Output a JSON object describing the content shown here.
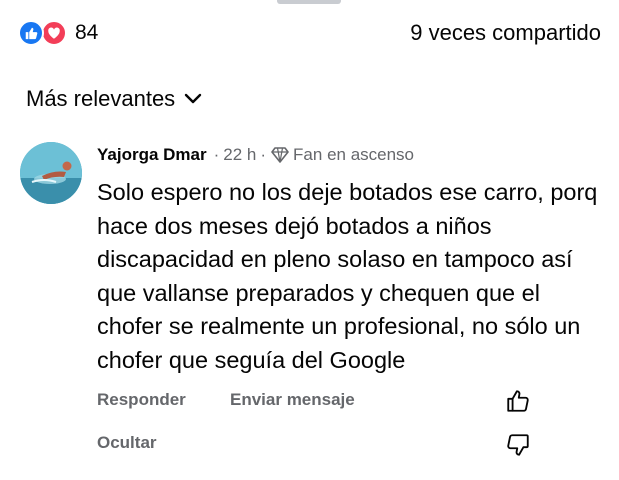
{
  "reactions": {
    "icons": [
      "like-icon",
      "love-icon"
    ],
    "count": "84",
    "shares": "9 veces compartido"
  },
  "sort": {
    "label": "Más relevantes",
    "icon": "chevron-down-icon"
  },
  "comment": {
    "author": "Yajorga Dmar",
    "time": "22 h",
    "separator": "·",
    "badge_icon": "diamond-badge-icon",
    "badge": "Fan en ascenso",
    "text": "Solo espero no los deje botados ese carro, porq hace dos meses dejó botados a niños discapacidad en pleno solaso en tampoco así que vallanse preparados y chequen que el chofer se realmente un profesional, no sólo un chofer que seguía del Google",
    "actions": {
      "reply": "Responder",
      "message": "Enviar mensaje",
      "hide": "Ocultar"
    },
    "vote_icons": [
      "thumbs-up-outline-icon",
      "thumbs-down-outline-icon"
    ]
  },
  "colors": {
    "like": "#1877f2",
    "love": "#f33e58",
    "secondary_text": "#65676b",
    "primary_text": "#050505"
  }
}
